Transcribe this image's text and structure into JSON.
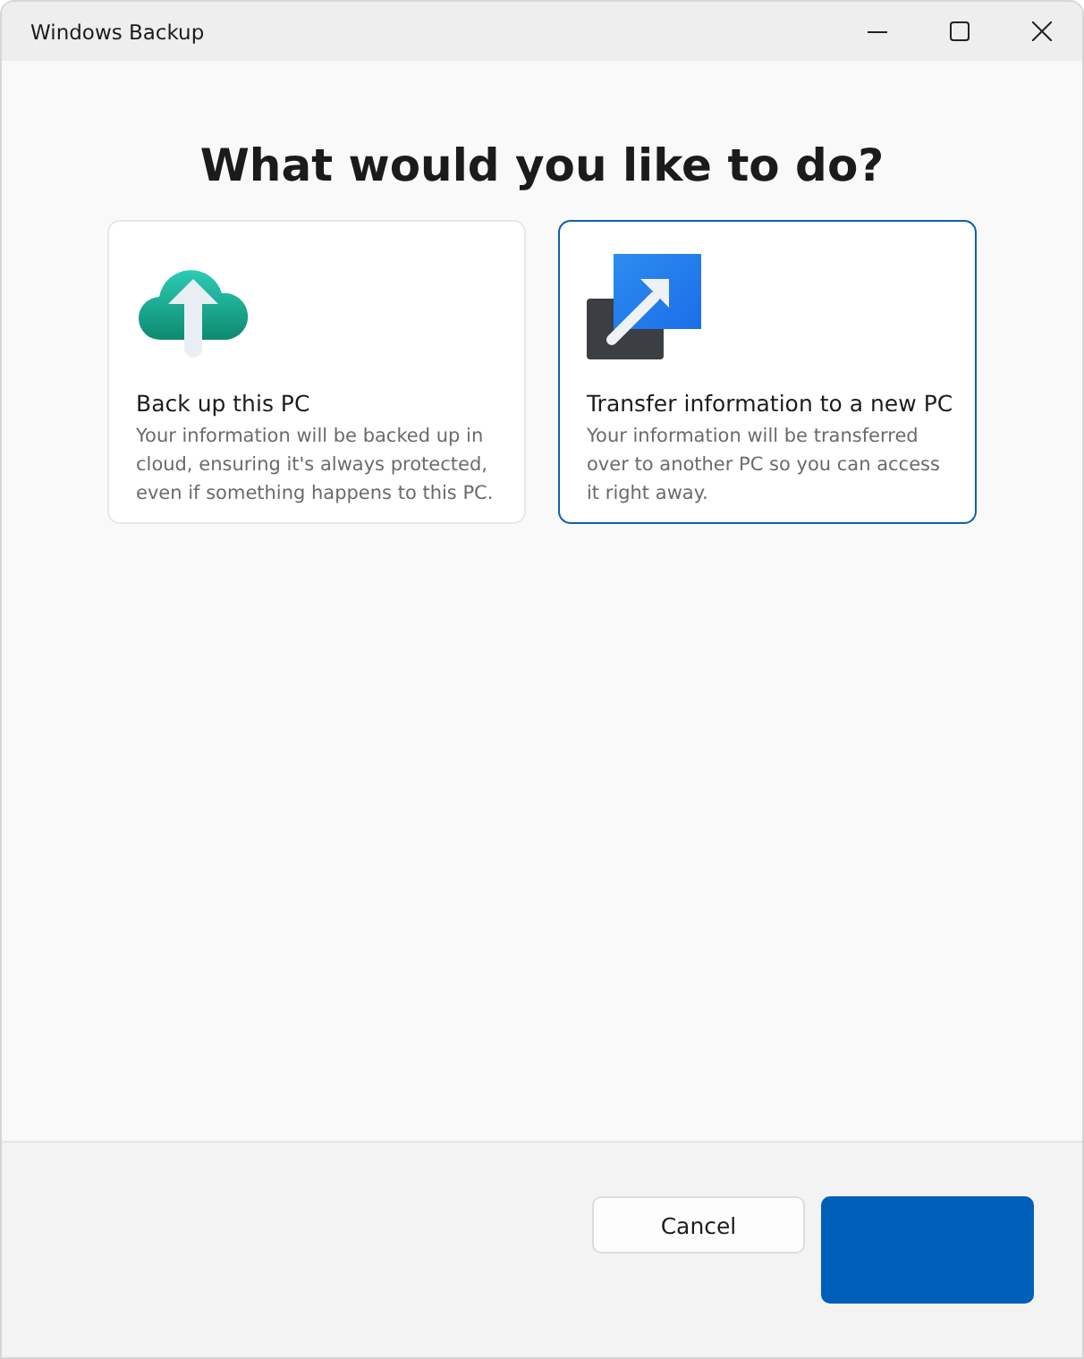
{
  "window": {
    "title": "Windows Backup"
  },
  "heading": "What would you like to do?",
  "options": [
    {
      "kind": "cloud",
      "title": "Back up this PC",
      "description": "Your information will be backed up in cloud, ensuring it's always protected, even if something happens to this PC.",
      "selected": false
    },
    {
      "kind": "transfer",
      "title": "Transfer information to a new PC",
      "description": "Your information will be transferred over to another PC so you can access it right away.",
      "selected": true
    }
  ],
  "buttons": [
    {
      "kind": "secondary",
      "label": "Cancel"
    },
    {
      "kind": "primary"
    }
  ]
}
